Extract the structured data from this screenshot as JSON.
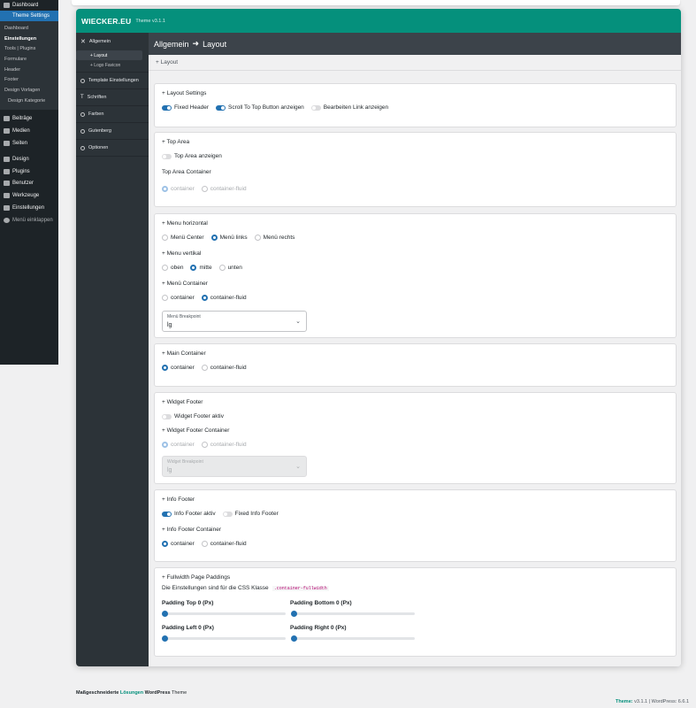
{
  "wp_menu": {
    "dashboard": "Dashboard",
    "theme_settings": "Theme Settings",
    "submenu": [
      "Dashboard",
      "Einstellungen",
      "Tools | Plugins",
      "Formulare",
      "Header",
      "Footer",
      "Design Vorlagen",
      "Design Kategorie"
    ],
    "items": [
      "Beiträge",
      "Medien",
      "Seiten",
      "Design",
      "Plugins",
      "Benutzer",
      "Werkzeuge",
      "Einstellungen",
      "Menü einklappen"
    ]
  },
  "brand": {
    "logo": "WIECKER.EU",
    "version": "Theme v3.1.1",
    "accent": "#05907c"
  },
  "sidebar": {
    "allgemein": "Allgemein",
    "layout": "+ Layout",
    "logo_favicon": "+ Logo Favicon",
    "template": "Template Einstellungen",
    "schriften": "Schriften",
    "farben": "Farben",
    "gutenberg": "Gutenberg",
    "optionen": "Optionen"
  },
  "header": {
    "section": "Allgemein",
    "arrow": "➜",
    "page": "Layout"
  },
  "crumb": "+ Layout",
  "layout_settings": {
    "title": "+ Layout Settings",
    "fixed_header": "Fixed Header",
    "scroll_top": "Scroll To Top Button anzeigen",
    "edit_link": "Bearbeiten Link anzeigen"
  },
  "top_area": {
    "title": "+ Top Area",
    "show": "Top Area anzeigen",
    "container_title": "Top Area Container",
    "opt1": "container",
    "opt2": "container-fluid"
  },
  "menu": {
    "horizontal": "+ Menu horizontal",
    "h1": "Menü Center",
    "h2": "Menü links",
    "h3": "Menü rechts",
    "vertical": "+ Menu vertikal",
    "v1": "oben",
    "v2": "mitte",
    "v3": "unten",
    "container": "+ Menü Container",
    "c1": "container",
    "c2": "container-fluid",
    "breakpoint_label": "Menü Breakpoint",
    "breakpoint_value": "lg"
  },
  "main_container": {
    "title": "+ Main Container",
    "opt1": "container",
    "opt2": "container-fluid"
  },
  "widget_footer": {
    "title": "+ Widget Footer",
    "active": "Widget Footer aktiv",
    "container": "+ Widget Footer Container",
    "opt1": "container",
    "opt2": "container-fluid",
    "breakpoint_label": "Widget Breakpoint",
    "breakpoint_value": "lg"
  },
  "info_footer": {
    "title": "+ Info Footer",
    "active": "Info Footer aktiv",
    "fixed": "Fixed Info Footer",
    "container": "+ Info Footer Container",
    "opt1": "container",
    "opt2": "container-fluid"
  },
  "paddings": {
    "title": "+ Fullwidth Page Paddings",
    "desc": "Die Einstellungen sind für die CSS Klasse",
    "code": ".container-fullwidth",
    "top": "Padding Top 0 (Px)",
    "bottom": "Padding Bottom 0 (Px)",
    "left": "Padding Left 0 (Px)",
    "right": "Padding Right 0 (Px)",
    "values": {
      "top": 0,
      "bottom": 0,
      "left": 0,
      "right": 0
    }
  },
  "footer": {
    "left_pre": "Maßgeschneiderte",
    "left_acc": "Lösungen",
    "left_post": "WordPress",
    "left_end": "Theme",
    "right_theme": "Theme:",
    "right_ver": "v3.1.1",
    "right_sep": "|",
    "right_wp": "WordPress: 6.6.1"
  }
}
